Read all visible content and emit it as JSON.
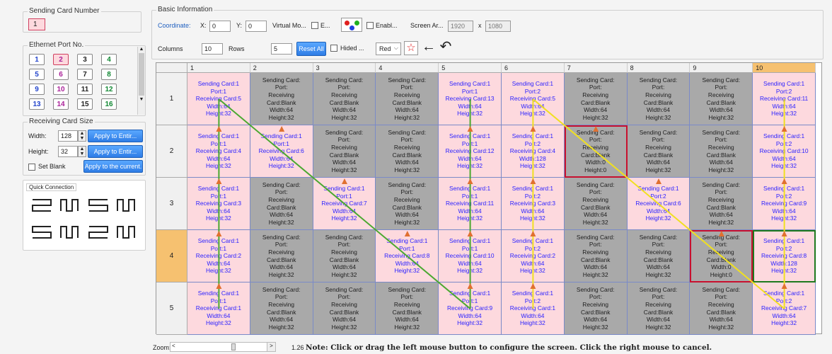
{
  "left": {
    "sending_card_title": "Sending Card Number",
    "sending_card_value": "1",
    "ethernet_title": "Ethernet Port No.",
    "ports": [
      "1",
      "2",
      "3",
      "4",
      "5",
      "6",
      "7",
      "8",
      "9",
      "10",
      "11",
      "12",
      "13",
      "14",
      "15",
      "16"
    ],
    "port_colors": [
      "#2244cc",
      "#aa2299",
      "#222222",
      "#118833",
      "#2244cc",
      "#aa2299",
      "#222222",
      "#118833",
      "#2244cc",
      "#aa2299",
      "#222222",
      "#118833",
      "#2244cc",
      "#aa2299",
      "#222222",
      "#118833"
    ],
    "rcs_title": "Receiving Card Size",
    "width_label": "Width:",
    "width_value": "128",
    "height_label": "Height:",
    "height_value": "32",
    "apply_entire_1": "Apply to Entir...",
    "apply_entire_2": "Apply to Entir...",
    "set_blank": "Set Blank",
    "apply_current": "Apply to the current.",
    "quick_title": "Quick Connection"
  },
  "basic": {
    "title": "Basic Information",
    "coordinate": "Coordinate:",
    "x_label": "X:",
    "x_value": "0",
    "y_label": "Y:",
    "y_value": "0",
    "virtual_mode": "Virtual Mo...",
    "e_label": "E...",
    "enable_label": "Enabl...",
    "screen_area": "Screen Ar...",
    "screen_w": "1920",
    "x_sep": "x",
    "screen_h": "1080",
    "columns_label": "Columns",
    "columns_value": "10",
    "rows_label": "Rows",
    "rows_value": "5",
    "reset_all": "Reset All",
    "hided": "Hided ...",
    "color_value": "Red"
  },
  "grid": {
    "col_headers": [
      "1",
      "2",
      "3",
      "4",
      "5",
      "6",
      "7",
      "8",
      "9",
      "10"
    ],
    "row_headers": [
      "1",
      "2",
      "3",
      "4",
      "5"
    ],
    "selected_col": "10",
    "selected_row": "4",
    "cells": [
      [
        [
          "Sending Card:1",
          "Port:1",
          "Receiving Card:5",
          "Width:64",
          "Height:32"
        ],
        [
          "Sending Card:",
          "Port:",
          "Receiving",
          "Card:Blank",
          "Width:64",
          "Height:32"
        ],
        [
          "Sending Card:",
          "Port:",
          "Receiving",
          "Card:Blank",
          "Width:64",
          "Height:32"
        ],
        [
          "Sending Card:",
          "Port:",
          "Receiving",
          "Card:Blank",
          "Width:64",
          "Height:32"
        ],
        [
          "Sending Card:1",
          "Port:1",
          "Receiving Card:13",
          "Width:64",
          "Height:32"
        ],
        [
          "Sending Card:1",
          "Port:2",
          "Receiving Card:5",
          "Width:64",
          "Height:32"
        ],
        [
          "Sending Card:",
          "Port:",
          "Receiving",
          "Card:Blank",
          "Width:64",
          "Height:32"
        ],
        [
          "Sending Card:",
          "Port:",
          "Receiving",
          "Card:Blank",
          "Width:64",
          "Height:32"
        ],
        [
          "Sending Card:",
          "Port:",
          "Receiving",
          "Card:Blank",
          "Width:64",
          "Height:32"
        ],
        [
          "Sending Card:1",
          "Port:2",
          "Receiving Card:11",
          "Width:64",
          "Height:32"
        ]
      ],
      [
        [
          "Sending Card:1",
          "Port:1",
          "Receiving Card:4",
          "Width:64",
          "Height:32"
        ],
        [
          "Sending Card:1",
          "Port:1",
          "Receiving Card:6",
          "Width:64",
          "Height:32"
        ],
        [
          "Sending Card:",
          "Port:",
          "Receiving",
          "Card:Blank",
          "Width:64",
          "Height:32"
        ],
        [
          "Sending Card:",
          "Port:",
          "Receiving",
          "Card:Blank",
          "Width:64",
          "Height:32"
        ],
        [
          "Sending Card:1",
          "Port:1",
          "Receiving Card:12",
          "Width:64",
          "Height:32"
        ],
        [
          "Sending Card:1",
          "Port:2",
          "Receiving Card:4",
          "Width:128",
          "Height:32"
        ],
        [
          "Sending Card:",
          "Port:",
          "Receiving",
          "Card:Blank",
          "Width:0",
          "Height:0"
        ],
        [
          "Sending Card:",
          "Port:",
          "Receiving",
          "Card:Blank",
          "Width:64",
          "Height:32"
        ],
        [
          "Sending Card:",
          "Port:",
          "Receiving",
          "Card:Blank",
          "Width:64",
          "Height:32"
        ],
        [
          "Sending Card:1",
          "Port:2",
          "Receiving Card:10",
          "Width:64",
          "Height:32"
        ]
      ],
      [
        [
          "Sending Card:1",
          "Port:1",
          "Receiving Card:3",
          "Width:64",
          "Height:32"
        ],
        [
          "Sending Card:",
          "Port:",
          "Receiving",
          "Card:Blank",
          "Width:64",
          "Height:32"
        ],
        [
          "Sending Card:1",
          "Port:1",
          "Receiving Card:7",
          "Width:64",
          "Height:32"
        ],
        [
          "Sending Card:",
          "Port:",
          "Receiving",
          "Card:Blank",
          "Width:64",
          "Height:32"
        ],
        [
          "Sending Card:1",
          "Port:1",
          "Receiving Card:11",
          "Width:64",
          "Height:32"
        ],
        [
          "Sending Card:1",
          "Port:2",
          "Receiving Card:3",
          "Width:64",
          "Height:32"
        ],
        [
          "Sending Card:",
          "Port:",
          "Receiving",
          "Card:Blank",
          "Width:64",
          "Height:32"
        ],
        [
          "Sending Card:1",
          "Port:2",
          "Receiving Card:6",
          "Width:64",
          "Height:32"
        ],
        [
          "Sending Card:",
          "Port:",
          "Receiving",
          "Card:Blank",
          "Width:64",
          "Height:32"
        ],
        [
          "Sending Card:1",
          "Port:2",
          "Receiving Card:9",
          "Width:64",
          "Height:32"
        ]
      ],
      [
        [
          "Sending Card:1",
          "Port:1",
          "Receiving Card:2",
          "Width:64",
          "Height:32"
        ],
        [
          "Sending Card:",
          "Port:",
          "Receiving",
          "Card:Blank",
          "Width:64",
          "Height:32"
        ],
        [
          "Sending Card:",
          "Port:",
          "Receiving",
          "Card:Blank",
          "Width:64",
          "Height:32"
        ],
        [
          "Sending Card:1",
          "Port:1",
          "Receiving Card:8",
          "Width:64",
          "Height:32"
        ],
        [
          "Sending Card:1",
          "Port:1",
          "Receiving Card:10",
          "Width:64",
          "Height:32"
        ],
        [
          "Sending Card:1",
          "Port:2",
          "Receiving Card:2",
          "Width:64",
          "Height:32"
        ],
        [
          "Sending Card:",
          "Port:",
          "Receiving",
          "Card:Blank",
          "Width:64",
          "Height:32"
        ],
        [
          "Sending Card:",
          "Port:",
          "Receiving",
          "Card:Blank",
          "Width:64",
          "Height:32"
        ],
        [
          "Sending Card:",
          "Port:",
          "Receiving",
          "Card:Blank",
          "Width:0",
          "Height:0"
        ],
        [
          "Sending Card:1",
          "Port:2",
          "Receiving Card:8",
          "Width:128",
          "Height:32"
        ]
      ],
      [
        [
          "Sending Card:1",
          "Port:1",
          "Receiving Card:1",
          "Width:64",
          "Height:32"
        ],
        [
          "Sending Card:",
          "Port:",
          "Receiving",
          "Card:Blank",
          "Width:64",
          "Height:32"
        ],
        [
          "Sending Card:",
          "Port:",
          "Receiving",
          "Card:Blank",
          "Width:64",
          "Height:32"
        ],
        [
          "Sending Card:",
          "Port:",
          "Receiving",
          "Card:Blank",
          "Width:64",
          "Height:32"
        ],
        [
          "Sending Card:1",
          "Port:1",
          "Receiving Card:9",
          "Width:64",
          "Height:32"
        ],
        [
          "Sending Card:1",
          "Port:2",
          "Receiving Card:1",
          "Width:64",
          "Height:32"
        ],
        [
          "Sending Card:",
          "Port:",
          "Receiving",
          "Card:Blank",
          "Width:64",
          "Height:32"
        ],
        [
          "Sending Card:",
          "Port:",
          "Receiving",
          "Card:Blank",
          "Width:64",
          "Height:32"
        ],
        [
          "Sending Card:",
          "Port:",
          "Receiving",
          "Card:Blank",
          "Width:64",
          "Height:32"
        ],
        [
          "Sending Card:1",
          "Port:2",
          "Receiving Card:7",
          "Width:64",
          "Height:32"
        ]
      ]
    ],
    "highlight_red": [
      [
        1,
        6
      ],
      [
        3,
        8
      ]
    ],
    "highlight_green": [
      [
        3,
        9
      ]
    ]
  },
  "bottom": {
    "zoom_label": "Zoom:",
    "zoom_value": "1.26",
    "note": "Note: Click or drag the left mouse button to configure the screen. Click the right mouse to cancel."
  },
  "colors": {
    "pink": "#fdd9de",
    "gray": "#a9a9a9",
    "port1_line": "#4aa830",
    "port2_line": "#f0e020",
    "arrow": "#e07030"
  }
}
